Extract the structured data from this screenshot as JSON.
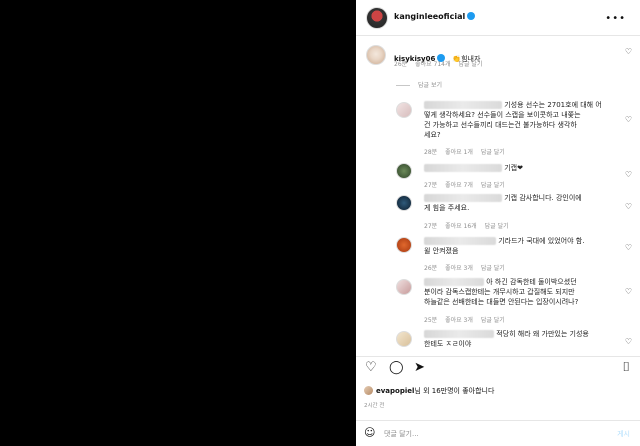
{
  "header": {
    "username": "kanginleeoficial"
  },
  "caption": {
    "username": "kisykisy06",
    "text": "👏힘내자",
    "time": "26분",
    "likes": "좋아요 714개",
    "reply": "답글 달기"
  },
  "view_replies": "답글 보기",
  "replies": [
    {
      "lines": [
        "기성용 선수는 2701호에 대해 어",
        "떻게 생각하세요? 선수들이 스캡을 보이콧하고 내쫓는",
        "건 가능하고 선수들끼리 대드는건 불가능하다 생각하",
        "세요?"
      ],
      "time": "28분",
      "likes": "좋아요 1개",
      "reply": "답글 달기"
    },
    {
      "lines": [
        "기캡❤"
      ],
      "time": "27분",
      "likes": "좋아요 7개",
      "reply": "답글 달기"
    },
    {
      "lines": [
        "기캡 감사합니다. 강인이에",
        "게 힘을 주세요."
      ],
      "time": "27분",
      "likes": "좋아요 16개",
      "reply": "답글 달기"
    },
    {
      "lines": [
        "기라드가 국대에 있었어야 함.",
        "윌 안켜졌음"
      ],
      "time": "26분",
      "likes": "좋아요 3개",
      "reply": "답글 달기"
    },
    {
      "lines": [
        "아 하긴 감독한테 둘이박으셨던",
        "분이라 감독스캡한테는 개무시하고 갑질해도 되지만",
        "하늘같은 선배한테는 대들면 안된다는 입장이시려나?"
      ],
      "time": "25분",
      "likes": "좋아요 3개",
      "reply": "답글 달기"
    },
    {
      "lines": [
        "적당히 해라 왜 가만있는 기성용",
        "한테도 ㅈㄹ이야"
      ],
      "time": "",
      "likes": "",
      "reply": ""
    }
  ],
  "liked_by": {
    "user": "evapopiel",
    "rest": "님 외 16만명이 좋아합니다"
  },
  "post_time": "2시간 전",
  "composer": {
    "placeholder": "댓글 달기...",
    "post": "게시"
  },
  "colors": {
    "verified": "#1d9bf0",
    "post_disabled": "#b2dffc"
  }
}
